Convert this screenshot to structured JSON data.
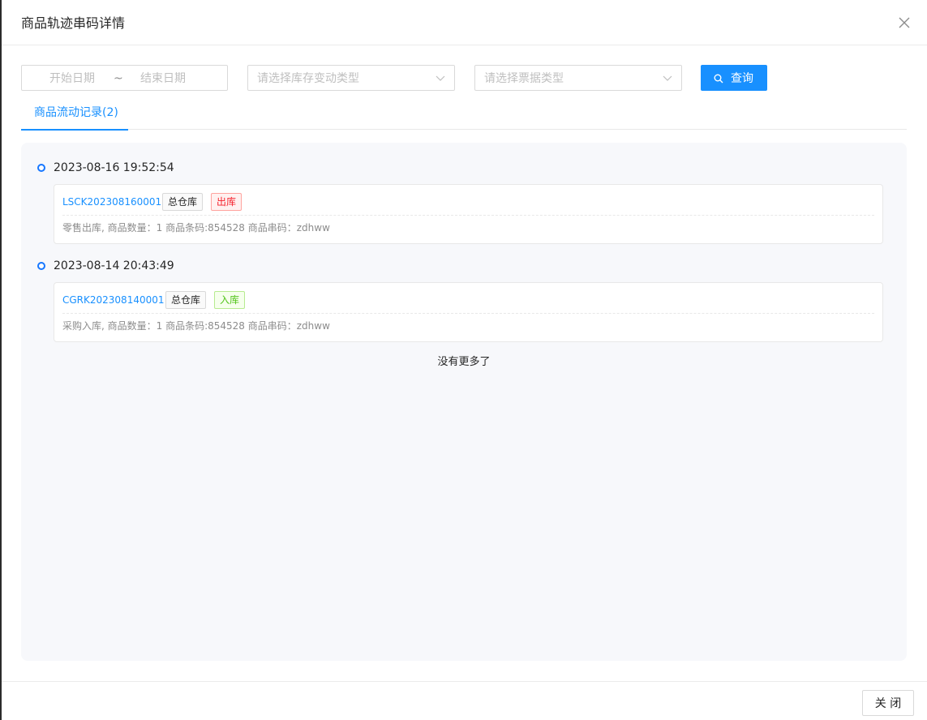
{
  "modal": {
    "title": "商品轨迹串码详情"
  },
  "filters": {
    "date_start_placeholder": "开始日期",
    "date_separator": "~",
    "date_end_placeholder": "结束日期",
    "stock_change_type_placeholder": "请选择库存变动类型",
    "bill_type_placeholder": "请选择票据类型",
    "query_label": "查询"
  },
  "tabs": [
    {
      "label": "商品流动记录(2)",
      "active": true
    }
  ],
  "records": [
    {
      "time": "2023-08-16 19:52:54",
      "doc_no": "LSCK202308160001",
      "warehouse": "总仓库",
      "direction": "出库",
      "desc": "零售出库, 商品数量：1 商品条码:854528 商品串码：zdhww"
    },
    {
      "time": "2023-08-14 20:43:49",
      "doc_no": "CGRK202308140001",
      "warehouse": "总仓库",
      "direction": "入库",
      "desc": "采购入库, 商品数量：1 商品条码:854528 商品串码：zdhww"
    }
  ],
  "list_end_text": "没有更多了",
  "footer": {
    "close_label": "关 闭"
  },
  "colors": {
    "primary": "#1890ff",
    "out_tag": "#f5222d",
    "in_tag": "#52c41a",
    "panel_bg": "#f7f8fb"
  },
  "icons": {
    "close": "close-icon",
    "dropdown": "chevron-down-icon",
    "search": "search-icon"
  }
}
